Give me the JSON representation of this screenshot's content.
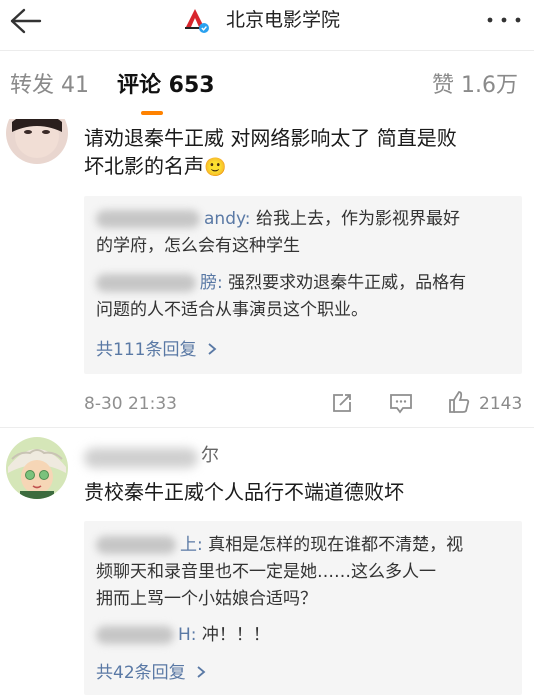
{
  "header": {
    "title": "北京电影学院",
    "back_icon": "back-arrow-icon",
    "more_icon": "more-dots-icon"
  },
  "tabs": [
    {
      "label": "转发 41"
    },
    {
      "label": "评论 653"
    },
    {
      "label": "赞 1.6万"
    }
  ],
  "comments": [
    {
      "text_line1": "请劝退秦牛正威 对网络影响太了 简直是败",
      "text_line2": "坏北影的名声",
      "emoji": "🙂",
      "replies": [
        {
          "name_visible": "andy:",
          "text_line1": "给我上去，作为影视界最好",
          "text_line2": "的学府，怎么会有这种学生"
        },
        {
          "name_visible": "膀:",
          "text_line1": "强烈要求劝退秦牛正威，品格有",
          "text_line2": "问题的人不适合从事演员这个职业。"
        }
      ],
      "more_replies": "共111条回复",
      "time": "8-30 21:33",
      "likes": "2143"
    },
    {
      "name_visible": "尔",
      "text_line1": "贵校秦牛正威个人品行不端道德败坏",
      "replies": [
        {
          "name_visible": "上:",
          "text_line1": "真相是怎样的现在谁都不清楚，视",
          "text_line2": "频聊天和录音里也不一定是她……这么多人一",
          "text_line3": "拥而上骂一个小姑娘合适吗？"
        },
        {
          "name_visible": "H:",
          "text_line1": "冲！！！"
        }
      ],
      "more_replies": "共42条回复"
    }
  ],
  "colors": {
    "accent": "#ff8200",
    "link": "#5a79a5"
  }
}
